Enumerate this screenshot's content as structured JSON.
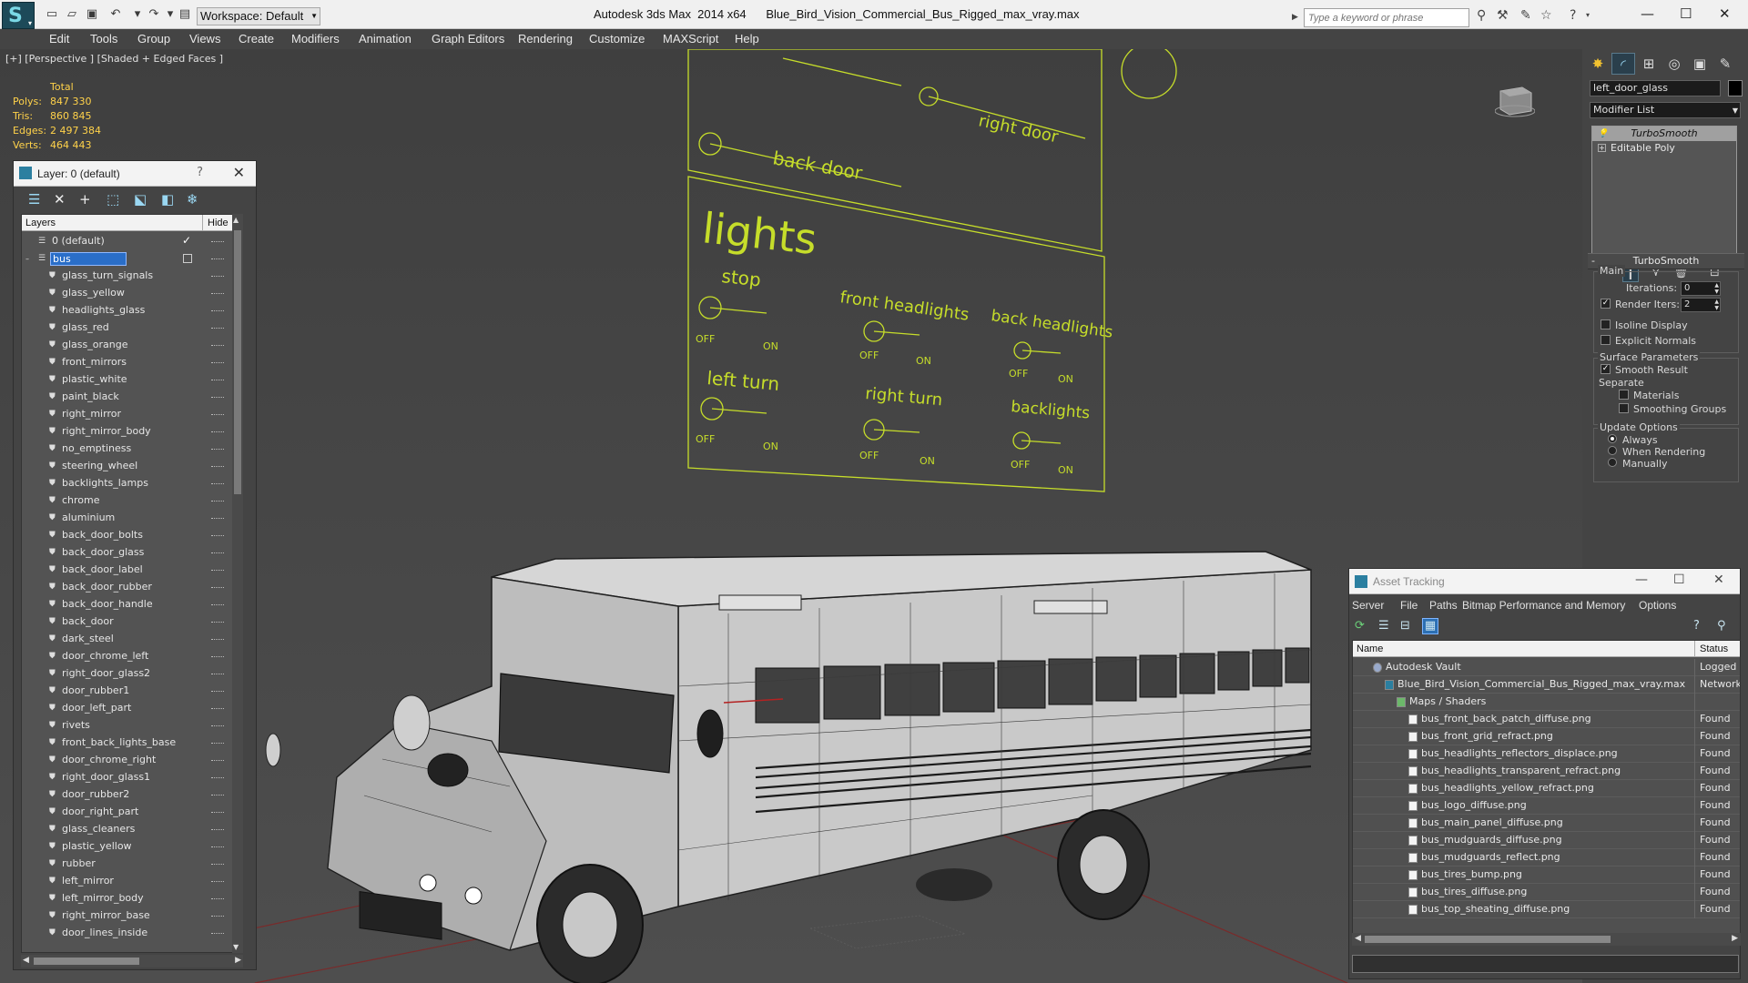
{
  "window": {
    "app_title": "Autodesk 3ds Max  2014 x64      Blue_Bird_Vision_Commercial_Bus_Rigged_max_vray.max",
    "workspace": "Workspace: Default",
    "search_placeholder": "Type a keyword or phrase"
  },
  "menu": [
    "Edit",
    "Tools",
    "Group",
    "Views",
    "Create",
    "Modifiers",
    "Animation",
    "Graph Editors",
    "Rendering",
    "Customize",
    "MAXScript",
    "Help"
  ],
  "viewport": {
    "label": "[+] [Perspective ] [Shaded + Edged Faces ]",
    "stats": {
      "heading": "Total",
      "rows": [
        {
          "key": "Polys:",
          "value": "847 330"
        },
        {
          "key": "Tris:",
          "value": "860 845"
        },
        {
          "key": "Edges:",
          "value": "2 497 384"
        },
        {
          "key": "Verts:",
          "value": "464 443"
        }
      ]
    },
    "control_panel": {
      "back_door": "back door",
      "right_door": "right door",
      "lights": "lights",
      "stop": "stop",
      "front_headlights": "front headlights",
      "back_headlights": "back  headlights",
      "left_turn": "left turn",
      "right_turn": "right turn",
      "backlights": "backlights",
      "off": "OFF",
      "on": "ON"
    },
    "colors": {
      "wire": "#c6dd2a",
      "ground_line": "#7a2a2a"
    }
  },
  "layer_dialog": {
    "title": "Layer: 0 (default)",
    "help": "?",
    "col_layers": "Layers",
    "col_hide": "Hide",
    "default_layer": "0 (default)",
    "selected_layer": "bus",
    "children": [
      "glass_turn_signals",
      "glass_yellow",
      "headlights_glass",
      "glass_red",
      "glass_orange",
      "front_mirrors",
      "plastic_white",
      "paint_black",
      "right_mirror",
      "right_mirror_body",
      "no_emptiness",
      "steering_wheel",
      "backlights_lamps",
      "chrome",
      "aluminium",
      "back_door_bolts",
      "back_door_glass",
      "back_door_label",
      "back_door_rubber",
      "back_door_handle",
      "back_door",
      "dark_steel",
      "door_chrome_left",
      "right_door_glass2",
      "door_rubber1",
      "door_left_part",
      "rivets",
      "front_back_lights_base",
      "door_chrome_right",
      "right_door_glass1",
      "door_rubber2",
      "door_right_part",
      "glass_cleaners",
      "plastic_yellow",
      "rubber",
      "left_mirror",
      "left_mirror_body",
      "right_mirror_base",
      "door_lines_inside"
    ]
  },
  "command_panel": {
    "object_name": "left_door_glass",
    "modifier_list": "Modifier List",
    "stack": [
      "TurboSmooth",
      "Editable Poly"
    ],
    "rollout": "TurboSmooth",
    "main_group": "Main",
    "iterations_label": "Iterations:",
    "iterations": "0",
    "render_iters_label": "Render Iters:",
    "render_iters": "2",
    "isoline": "Isoline Display",
    "explicit_normals": "Explicit Normals",
    "surface_group": "Surface Parameters",
    "smooth_result": "Smooth Result",
    "separate": "Separate",
    "materials": "Materials",
    "smoothing_groups": "Smoothing Groups",
    "update_group": "Update Options",
    "always": "Always",
    "when_rendering": "When Rendering",
    "manually": "Manually"
  },
  "asset_tracking": {
    "title": "Asset Tracking",
    "menu": [
      "Server",
      "File",
      "Paths",
      "Bitmap Performance and Memory",
      "Options"
    ],
    "col_name": "Name",
    "col_status": "Status",
    "rows": [
      {
        "name": "Autodesk Vault",
        "status": "Logged Out",
        "indent": 0,
        "icon": "vault"
      },
      {
        "name": "Blue_Bird_Vision_Commercial_Bus_Rigged_max_vray.max",
        "status": "Network",
        "indent": 1,
        "icon": "max"
      },
      {
        "name": "Maps / Shaders",
        "status": "",
        "indent": 2,
        "icon": "folder"
      },
      {
        "name": "bus_front_back_patch_diffuse.png",
        "status": "Found",
        "indent": 3,
        "icon": "img"
      },
      {
        "name": "bus_front_grid_refract.png",
        "status": "Found",
        "indent": 3,
        "icon": "img"
      },
      {
        "name": "bus_headlights_reflectors_displace.png",
        "status": "Found",
        "indent": 3,
        "icon": "img"
      },
      {
        "name": "bus_headlights_transparent_refract.png",
        "status": "Found",
        "indent": 3,
        "icon": "img"
      },
      {
        "name": "bus_headlights_yellow_refract.png",
        "status": "Found",
        "indent": 3,
        "icon": "img"
      },
      {
        "name": "bus_logo_diffuse.png",
        "status": "Found",
        "indent": 3,
        "icon": "img"
      },
      {
        "name": "bus_main_panel_diffuse.png",
        "status": "Found",
        "indent": 3,
        "icon": "img"
      },
      {
        "name": "bus_mudguards_diffuse.png",
        "status": "Found",
        "indent": 3,
        "icon": "img"
      },
      {
        "name": "bus_mudguards_reflect.png",
        "status": "Found",
        "indent": 3,
        "icon": "img"
      },
      {
        "name": "bus_tires_bump.png",
        "status": "Found",
        "indent": 3,
        "icon": "img"
      },
      {
        "name": "bus_tires_diffuse.png",
        "status": "Found",
        "indent": 3,
        "icon": "img"
      },
      {
        "name": "bus_top_sheating_diffuse.png",
        "status": "Found",
        "indent": 3,
        "icon": "img"
      }
    ]
  }
}
